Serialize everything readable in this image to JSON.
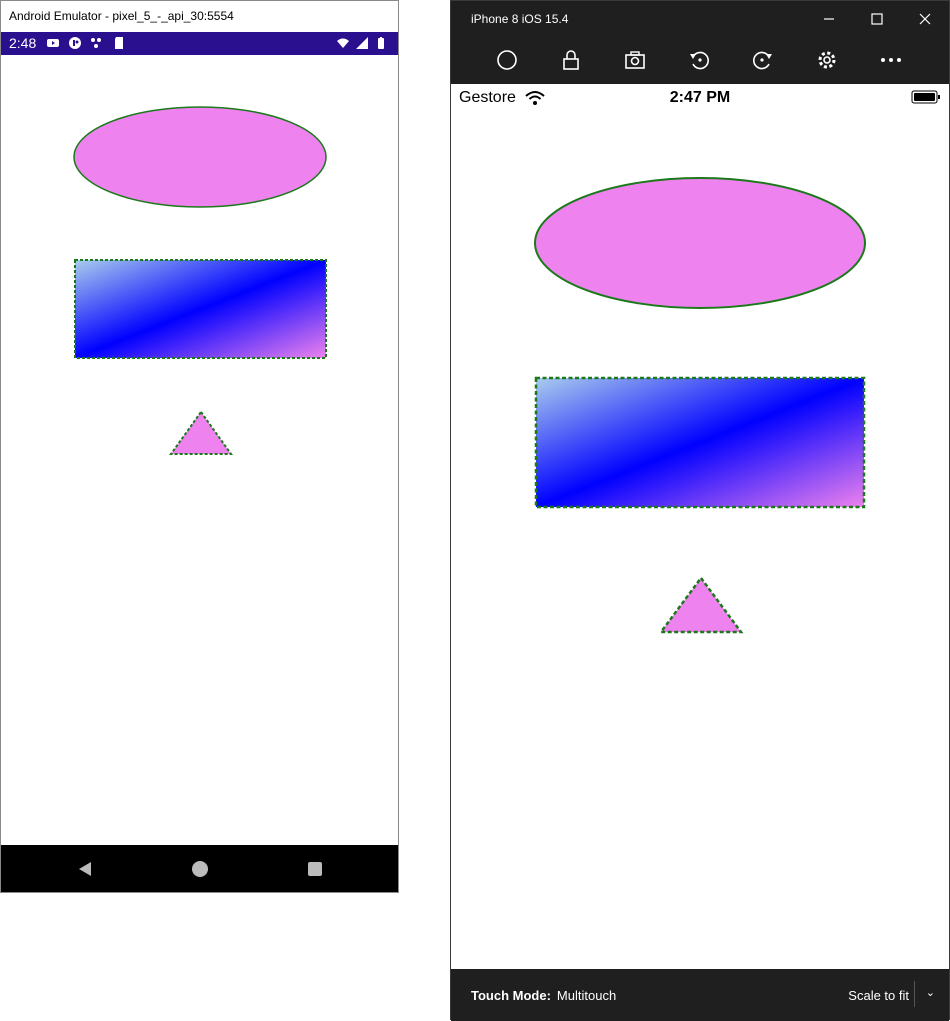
{
  "android": {
    "window_title": "Android Emulator - pixel_5_-_api_30:5554",
    "status_time": "2:48",
    "status_bar_color": "#2a0f8f"
  },
  "ios": {
    "window_title": "iPhone 8 iOS 15.4",
    "carrier": "Gestore",
    "status_time": "2:47 PM",
    "touch_mode_label": "Touch Mode:",
    "touch_mode_value": "Multitouch",
    "scale_label": "Scale to fit"
  },
  "shapes": {
    "ellipse_fill": "#ee82ee",
    "stroke_color": "#1a7a1a",
    "gradient_stops": [
      "#aaccee",
      "#0000ff",
      "#ee82ee"
    ],
    "triangle_fill": "#ee82ee"
  }
}
